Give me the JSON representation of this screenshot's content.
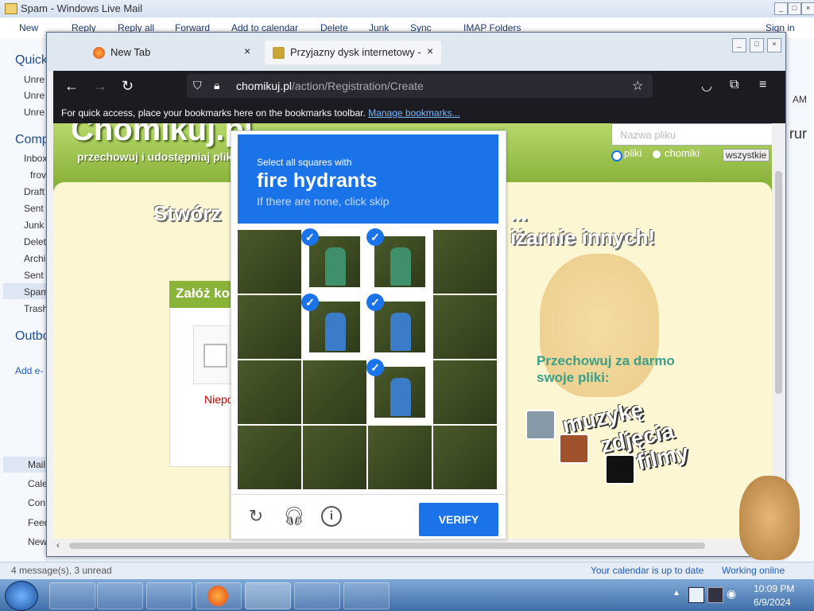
{
  "wlm": {
    "title": "Spam - Windows Live Mail",
    "toolbar": [
      "New",
      "Reply",
      "Reply all",
      "Forward",
      "Add to calendar",
      "Delete",
      "Junk",
      "Sync",
      "IMAP Folders"
    ],
    "sign_in": "Sign in",
    "sidebar": {
      "quick": "Quick",
      "quick_items": [
        "Unre",
        "Unre",
        "Unre"
      ],
      "comp": "Comp",
      "folders": [
        "Inbox",
        "frov",
        "Draft",
        "Sent",
        "Junk",
        "Delet",
        "Archi",
        "Sent",
        "Spam",
        "Trash"
      ],
      "outbox": "Outbo",
      "add": "Add e-",
      "bottom": [
        "Mail",
        "Cale",
        "Con",
        "Feed",
        "New"
      ]
    },
    "right_frag_1": "AM",
    "right_frag_2": "rur",
    "status_left": "4 message(s), 3 unread",
    "status_right": "Your calendar is up to date",
    "status_online": "Working online"
  },
  "firefox": {
    "tabs": [
      {
        "label": "New Tab"
      },
      {
        "label": "Przyjazny dysk internetowy - Ch"
      }
    ],
    "url_host": "chomikuj.pl",
    "url_path": "/action/Registration/Create",
    "bookmarks_msg": "For quick access, place your bookmarks here on the bookmarks toolbar.",
    "bookmarks_link": "Manage bookmarks..."
  },
  "site": {
    "logo": "Chomikuj.pl",
    "tagline": "przechowuj i udostępniaj pliki",
    "search_placeholder": "Nazwa pliku",
    "radio_files": "pliki",
    "radio_users": "chomiki",
    "filter": "wszystkie",
    "headline_left": "Stwórz",
    "headline_right": "...",
    "headline_line2": "iżarnie innych!",
    "zaloz": "Załóż kor",
    "error": "Niepc",
    "promo_line1": "Przechowuj za darmo",
    "promo_line2": "swoje pliki:",
    "cat_music": "muzykę",
    "cat_photos": "zdjęcia",
    "cat_movies": "filmy"
  },
  "captcha": {
    "line1": "Select all squares with",
    "line2": "fire hydrants",
    "line3": "If there are none, click skip",
    "verify": "VERIFY",
    "selected_cells": [
      1,
      2,
      5,
      6,
      10
    ],
    "checkmark": "✓"
  },
  "taskbar": {
    "time": "10:09 PM",
    "date": "6/9/2024"
  },
  "colors": {
    "captcha_blue": "#1a73e8",
    "site_green": "#8ab33a",
    "site_cream": "#fdf6d2"
  }
}
